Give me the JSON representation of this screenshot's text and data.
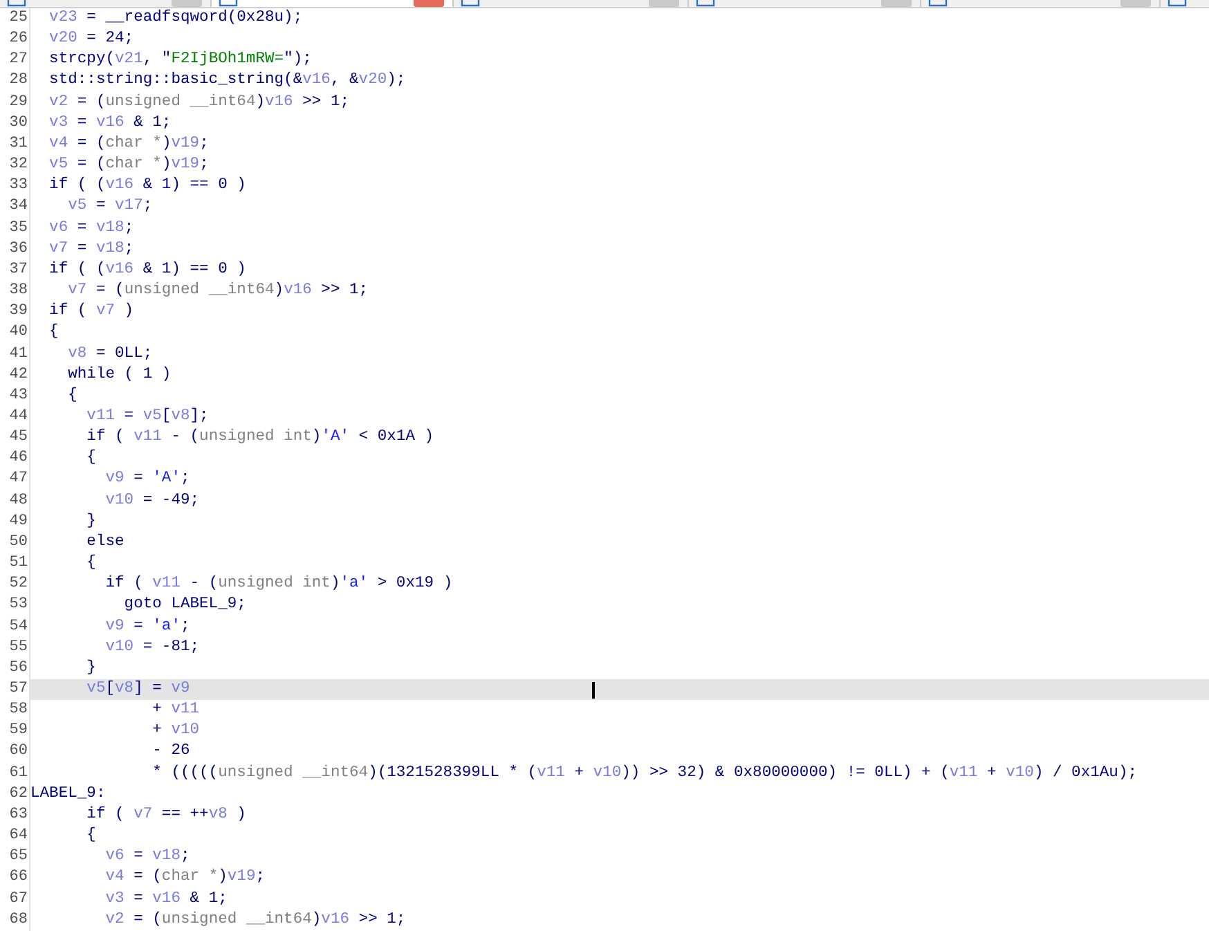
{
  "tabs": [
    {
      "selected": false
    },
    {
      "selected": true
    },
    {
      "selected": false
    },
    {
      "selected": false
    },
    {
      "selected": false
    },
    {
      "selected": false
    }
  ],
  "code": {
    "lines": [
      {
        "number": "25",
        "selected": false,
        "tokens": [
          {
            "text": "  v23",
            "kind": "var"
          },
          {
            "text": " = __readfsqword(0x28u);",
            "kind": "plain"
          }
        ]
      },
      {
        "number": "26",
        "selected": false,
        "tokens": [
          {
            "text": "  v20",
            "kind": "var"
          },
          {
            "text": " = 24;",
            "kind": "plain"
          }
        ]
      },
      {
        "number": "27",
        "selected": false,
        "tokens": [
          {
            "text": "  strcpy(",
            "kind": "plain"
          },
          {
            "text": "v21",
            "kind": "var"
          },
          {
            "text": ", \"",
            "kind": "plain"
          },
          {
            "text": "F2IjBOh1mRW=",
            "kind": "string"
          },
          {
            "text": "\");",
            "kind": "plain"
          }
        ]
      },
      {
        "number": "28",
        "selected": false,
        "tokens": [
          {
            "text": "  std::string::basic_string(&",
            "kind": "plain"
          },
          {
            "text": "v16",
            "kind": "var"
          },
          {
            "text": ", &",
            "kind": "plain"
          },
          {
            "text": "v20",
            "kind": "var"
          },
          {
            "text": ");",
            "kind": "plain"
          }
        ]
      },
      {
        "number": "29",
        "selected": false,
        "tokens": [
          {
            "text": "  v2",
            "kind": "var"
          },
          {
            "text": " = (",
            "kind": "plain"
          },
          {
            "text": "unsigned __int64",
            "kind": "type"
          },
          {
            "text": ")",
            "kind": "plain"
          },
          {
            "text": "v16",
            "kind": "var"
          },
          {
            "text": " >> 1;",
            "kind": "plain"
          }
        ]
      },
      {
        "number": "30",
        "selected": false,
        "tokens": [
          {
            "text": "  v3",
            "kind": "var"
          },
          {
            "text": " = ",
            "kind": "plain"
          },
          {
            "text": "v16",
            "kind": "var"
          },
          {
            "text": " & 1;",
            "kind": "plain"
          }
        ]
      },
      {
        "number": "31",
        "selected": false,
        "tokens": [
          {
            "text": "  v4",
            "kind": "var"
          },
          {
            "text": " = (",
            "kind": "plain"
          },
          {
            "text": "char *",
            "kind": "type"
          },
          {
            "text": ")",
            "kind": "plain"
          },
          {
            "text": "v19",
            "kind": "var"
          },
          {
            "text": ";",
            "kind": "plain"
          }
        ]
      },
      {
        "number": "32",
        "selected": false,
        "tokens": [
          {
            "text": "  v5",
            "kind": "var"
          },
          {
            "text": " = (",
            "kind": "plain"
          },
          {
            "text": "char *",
            "kind": "type"
          },
          {
            "text": ")",
            "kind": "plain"
          },
          {
            "text": "v19",
            "kind": "var"
          },
          {
            "text": ";",
            "kind": "plain"
          }
        ]
      },
      {
        "number": "33",
        "selected": false,
        "tokens": [
          {
            "text": "  if ( (",
            "kind": "plain"
          },
          {
            "text": "v16",
            "kind": "var"
          },
          {
            "text": " & 1) == 0 )",
            "kind": "plain"
          }
        ]
      },
      {
        "number": "34",
        "selected": false,
        "tokens": [
          {
            "text": "    v5",
            "kind": "var"
          },
          {
            "text": " = ",
            "kind": "plain"
          },
          {
            "text": "v17",
            "kind": "var"
          },
          {
            "text": ";",
            "kind": "plain"
          }
        ]
      },
      {
        "number": "35",
        "selected": false,
        "tokens": [
          {
            "text": "  v6",
            "kind": "var"
          },
          {
            "text": " = ",
            "kind": "plain"
          },
          {
            "text": "v18",
            "kind": "var"
          },
          {
            "text": ";",
            "kind": "plain"
          }
        ]
      },
      {
        "number": "36",
        "selected": false,
        "tokens": [
          {
            "text": "  v7",
            "kind": "var"
          },
          {
            "text": " = ",
            "kind": "plain"
          },
          {
            "text": "v18",
            "kind": "var"
          },
          {
            "text": ";",
            "kind": "plain"
          }
        ]
      },
      {
        "number": "37",
        "selected": false,
        "tokens": [
          {
            "text": "  if ( (",
            "kind": "plain"
          },
          {
            "text": "v16",
            "kind": "var"
          },
          {
            "text": " & 1) == 0 )",
            "kind": "plain"
          }
        ]
      },
      {
        "number": "38",
        "selected": false,
        "tokens": [
          {
            "text": "    v7",
            "kind": "var"
          },
          {
            "text": " = (",
            "kind": "plain"
          },
          {
            "text": "unsigned __int64",
            "kind": "type"
          },
          {
            "text": ")",
            "kind": "plain"
          },
          {
            "text": "v16",
            "kind": "var"
          },
          {
            "text": " >> 1;",
            "kind": "plain"
          }
        ]
      },
      {
        "number": "39",
        "selected": false,
        "tokens": [
          {
            "text": "  if ( ",
            "kind": "plain"
          },
          {
            "text": "v7",
            "kind": "var"
          },
          {
            "text": " )",
            "kind": "plain"
          }
        ]
      },
      {
        "number": "40",
        "selected": false,
        "tokens": [
          {
            "text": "  {",
            "kind": "plain"
          }
        ]
      },
      {
        "number": "41",
        "selected": false,
        "tokens": [
          {
            "text": "    v8",
            "kind": "var"
          },
          {
            "text": " = 0LL;",
            "kind": "plain"
          }
        ]
      },
      {
        "number": "42",
        "selected": false,
        "tokens": [
          {
            "text": "    while ( 1 )",
            "kind": "plain"
          }
        ]
      },
      {
        "number": "43",
        "selected": false,
        "tokens": [
          {
            "text": "    {",
            "kind": "plain"
          }
        ]
      },
      {
        "number": "44",
        "selected": false,
        "tokens": [
          {
            "text": "      v11",
            "kind": "var"
          },
          {
            "text": " = ",
            "kind": "plain"
          },
          {
            "text": "v5",
            "kind": "var"
          },
          {
            "text": "[",
            "kind": "plain"
          },
          {
            "text": "v8",
            "kind": "var"
          },
          {
            "text": "];",
            "kind": "plain"
          }
        ]
      },
      {
        "number": "45",
        "selected": false,
        "tokens": [
          {
            "text": "      if ( ",
            "kind": "plain"
          },
          {
            "text": "v11",
            "kind": "var"
          },
          {
            "text": " - (",
            "kind": "plain"
          },
          {
            "text": "unsigned int",
            "kind": "type"
          },
          {
            "text": ")",
            "kind": "plain"
          },
          {
            "text": "'A'",
            "kind": "char"
          },
          {
            "text": " < 0x1A )",
            "kind": "plain"
          }
        ]
      },
      {
        "number": "46",
        "selected": false,
        "tokens": [
          {
            "text": "      {",
            "kind": "plain"
          }
        ]
      },
      {
        "number": "47",
        "selected": false,
        "tokens": [
          {
            "text": "        v9",
            "kind": "var"
          },
          {
            "text": " = ",
            "kind": "plain"
          },
          {
            "text": "'A'",
            "kind": "char"
          },
          {
            "text": ";",
            "kind": "plain"
          }
        ]
      },
      {
        "number": "48",
        "selected": false,
        "tokens": [
          {
            "text": "        v10",
            "kind": "var"
          },
          {
            "text": " = -49;",
            "kind": "plain"
          }
        ]
      },
      {
        "number": "49",
        "selected": false,
        "tokens": [
          {
            "text": "      }",
            "kind": "plain"
          }
        ]
      },
      {
        "number": "50",
        "selected": false,
        "tokens": [
          {
            "text": "      else",
            "kind": "plain"
          }
        ]
      },
      {
        "number": "51",
        "selected": false,
        "tokens": [
          {
            "text": "      {",
            "kind": "plain"
          }
        ]
      },
      {
        "number": "52",
        "selected": false,
        "tokens": [
          {
            "text": "        if ( ",
            "kind": "plain"
          },
          {
            "text": "v11",
            "kind": "var"
          },
          {
            "text": " - (",
            "kind": "plain"
          },
          {
            "text": "unsigned int",
            "kind": "type"
          },
          {
            "text": ")",
            "kind": "plain"
          },
          {
            "text": "'a'",
            "kind": "char"
          },
          {
            "text": " > 0x19 )",
            "kind": "plain"
          }
        ]
      },
      {
        "number": "53",
        "selected": false,
        "tokens": [
          {
            "text": "          goto LABEL_9;",
            "kind": "plain"
          }
        ]
      },
      {
        "number": "54",
        "selected": false,
        "tokens": [
          {
            "text": "        v9",
            "kind": "var"
          },
          {
            "text": " = ",
            "kind": "plain"
          },
          {
            "text": "'a'",
            "kind": "char"
          },
          {
            "text": ";",
            "kind": "plain"
          }
        ]
      },
      {
        "number": "55",
        "selected": false,
        "tokens": [
          {
            "text": "        v10",
            "kind": "var"
          },
          {
            "text": " = -81;",
            "kind": "plain"
          }
        ]
      },
      {
        "number": "56",
        "selected": false,
        "tokens": [
          {
            "text": "      }",
            "kind": "plain"
          }
        ]
      },
      {
        "number": "57",
        "selected": true,
        "tokens": [
          {
            "text": "      v5",
            "kind": "var"
          },
          {
            "text": "[",
            "kind": "plain"
          },
          {
            "text": "v8",
            "kind": "var"
          },
          {
            "text": "] = ",
            "kind": "plain"
          },
          {
            "text": "v9",
            "kind": "var"
          }
        ]
      },
      {
        "number": "58",
        "selected": false,
        "tokens": [
          {
            "text": "             + ",
            "kind": "plain"
          },
          {
            "text": "v11",
            "kind": "var"
          }
        ]
      },
      {
        "number": "59",
        "selected": false,
        "tokens": [
          {
            "text": "             + ",
            "kind": "plain"
          },
          {
            "text": "v10",
            "kind": "var"
          }
        ]
      },
      {
        "number": "60",
        "selected": false,
        "tokens": [
          {
            "text": "             - 26",
            "kind": "plain"
          }
        ]
      },
      {
        "number": "61",
        "selected": false,
        "tokens": [
          {
            "text": "             * (((((",
            "kind": "plain"
          },
          {
            "text": "unsigned __int64",
            "kind": "type"
          },
          {
            "text": ")(1321528399LL * (",
            "kind": "plain"
          },
          {
            "text": "v11",
            "kind": "var"
          },
          {
            "text": " + ",
            "kind": "plain"
          },
          {
            "text": "v10",
            "kind": "var"
          },
          {
            "text": ")) >> 32) & 0x80000000) != 0LL) + (",
            "kind": "plain"
          },
          {
            "text": "v11",
            "kind": "var"
          },
          {
            "text": " + ",
            "kind": "plain"
          },
          {
            "text": "v10",
            "kind": "var"
          },
          {
            "text": ") / 0x1Au);",
            "kind": "plain"
          }
        ]
      },
      {
        "number": "62",
        "selected": false,
        "tokens": [
          {
            "text": "LABEL_9:",
            "kind": "plain"
          }
        ]
      },
      {
        "number": "63",
        "selected": false,
        "tokens": [
          {
            "text": "      if ( ",
            "kind": "plain"
          },
          {
            "text": "v7",
            "kind": "var"
          },
          {
            "text": " == ++",
            "kind": "plain"
          },
          {
            "text": "v8",
            "kind": "var"
          },
          {
            "text": " )",
            "kind": "plain"
          }
        ]
      },
      {
        "number": "64",
        "selected": false,
        "tokens": [
          {
            "text": "      {",
            "kind": "plain"
          }
        ]
      },
      {
        "number": "65",
        "selected": false,
        "tokens": [
          {
            "text": "        v6",
            "kind": "var"
          },
          {
            "text": " = ",
            "kind": "plain"
          },
          {
            "text": "v18",
            "kind": "var"
          },
          {
            "text": ";",
            "kind": "plain"
          }
        ]
      },
      {
        "number": "66",
        "selected": false,
        "tokens": [
          {
            "text": "        v4",
            "kind": "var"
          },
          {
            "text": " = (",
            "kind": "plain"
          },
          {
            "text": "char *",
            "kind": "type"
          },
          {
            "text": ")",
            "kind": "plain"
          },
          {
            "text": "v19",
            "kind": "var"
          },
          {
            "text": ";",
            "kind": "plain"
          }
        ]
      },
      {
        "number": "67",
        "selected": false,
        "tokens": [
          {
            "text": "        v3",
            "kind": "var"
          },
          {
            "text": " = ",
            "kind": "plain"
          },
          {
            "text": "v16",
            "kind": "var"
          },
          {
            "text": " & 1;",
            "kind": "plain"
          }
        ]
      },
      {
        "number": "68",
        "selected": false,
        "tokens": [
          {
            "text": "        v2",
            "kind": "var"
          },
          {
            "text": " = (",
            "kind": "plain"
          },
          {
            "text": "unsigned __int64",
            "kind": "type"
          },
          {
            "text": ")",
            "kind": "plain"
          },
          {
            "text": "v16",
            "kind": "var"
          },
          {
            "text": " >> 1;",
            "kind": "plain"
          }
        ]
      }
    ]
  }
}
